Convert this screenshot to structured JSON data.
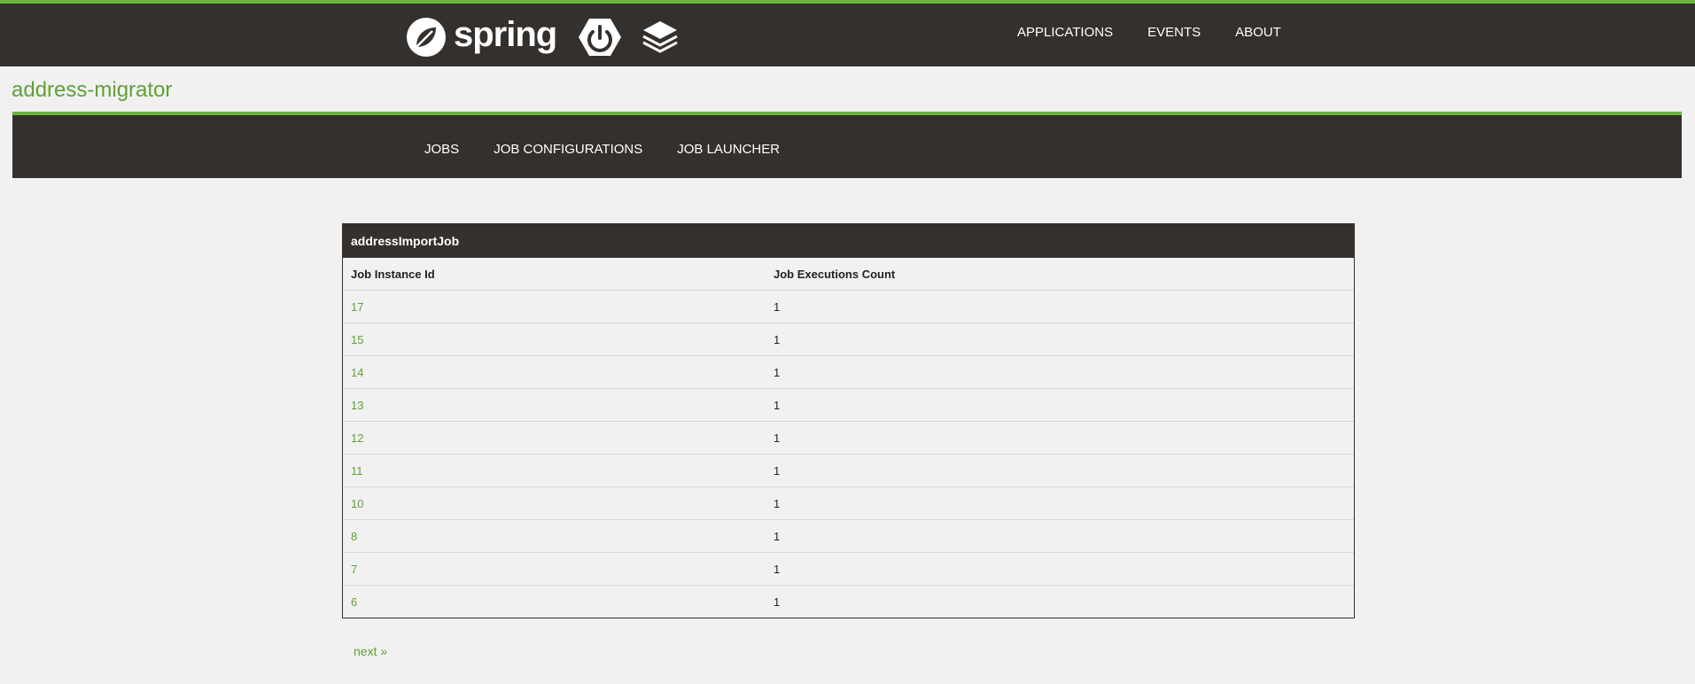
{
  "header": {
    "brand_name": "spring",
    "nav": [
      {
        "label": "APPLICATIONS"
      },
      {
        "label": "EVENTS"
      },
      {
        "label": "ABOUT"
      }
    ]
  },
  "app": {
    "title": "address-migrator"
  },
  "subnav": {
    "items": [
      {
        "label": "JOBS"
      },
      {
        "label": "JOB CONFIGURATIONS"
      },
      {
        "label": "JOB LAUNCHER"
      }
    ]
  },
  "job_table": {
    "title": "addressImportJob",
    "columns": [
      "Job Instance Id",
      "Job Executions Count"
    ],
    "rows": [
      {
        "id": "17",
        "count": "1"
      },
      {
        "id": "15",
        "count": "1"
      },
      {
        "id": "14",
        "count": "1"
      },
      {
        "id": "13",
        "count": "1"
      },
      {
        "id": "12",
        "count": "1"
      },
      {
        "id": "11",
        "count": "1"
      },
      {
        "id": "10",
        "count": "1"
      },
      {
        "id": "8",
        "count": "1"
      },
      {
        "id": "7",
        "count": "1"
      },
      {
        "id": "6",
        "count": "1"
      }
    ]
  },
  "pager": {
    "next_label": "next »"
  },
  "colors": {
    "brand_green": "#6db33f",
    "link_green": "#5fa134",
    "bar_dark": "#34302d"
  },
  "icons": [
    "spring-leaf-icon",
    "power-icon",
    "layers-icon"
  ]
}
